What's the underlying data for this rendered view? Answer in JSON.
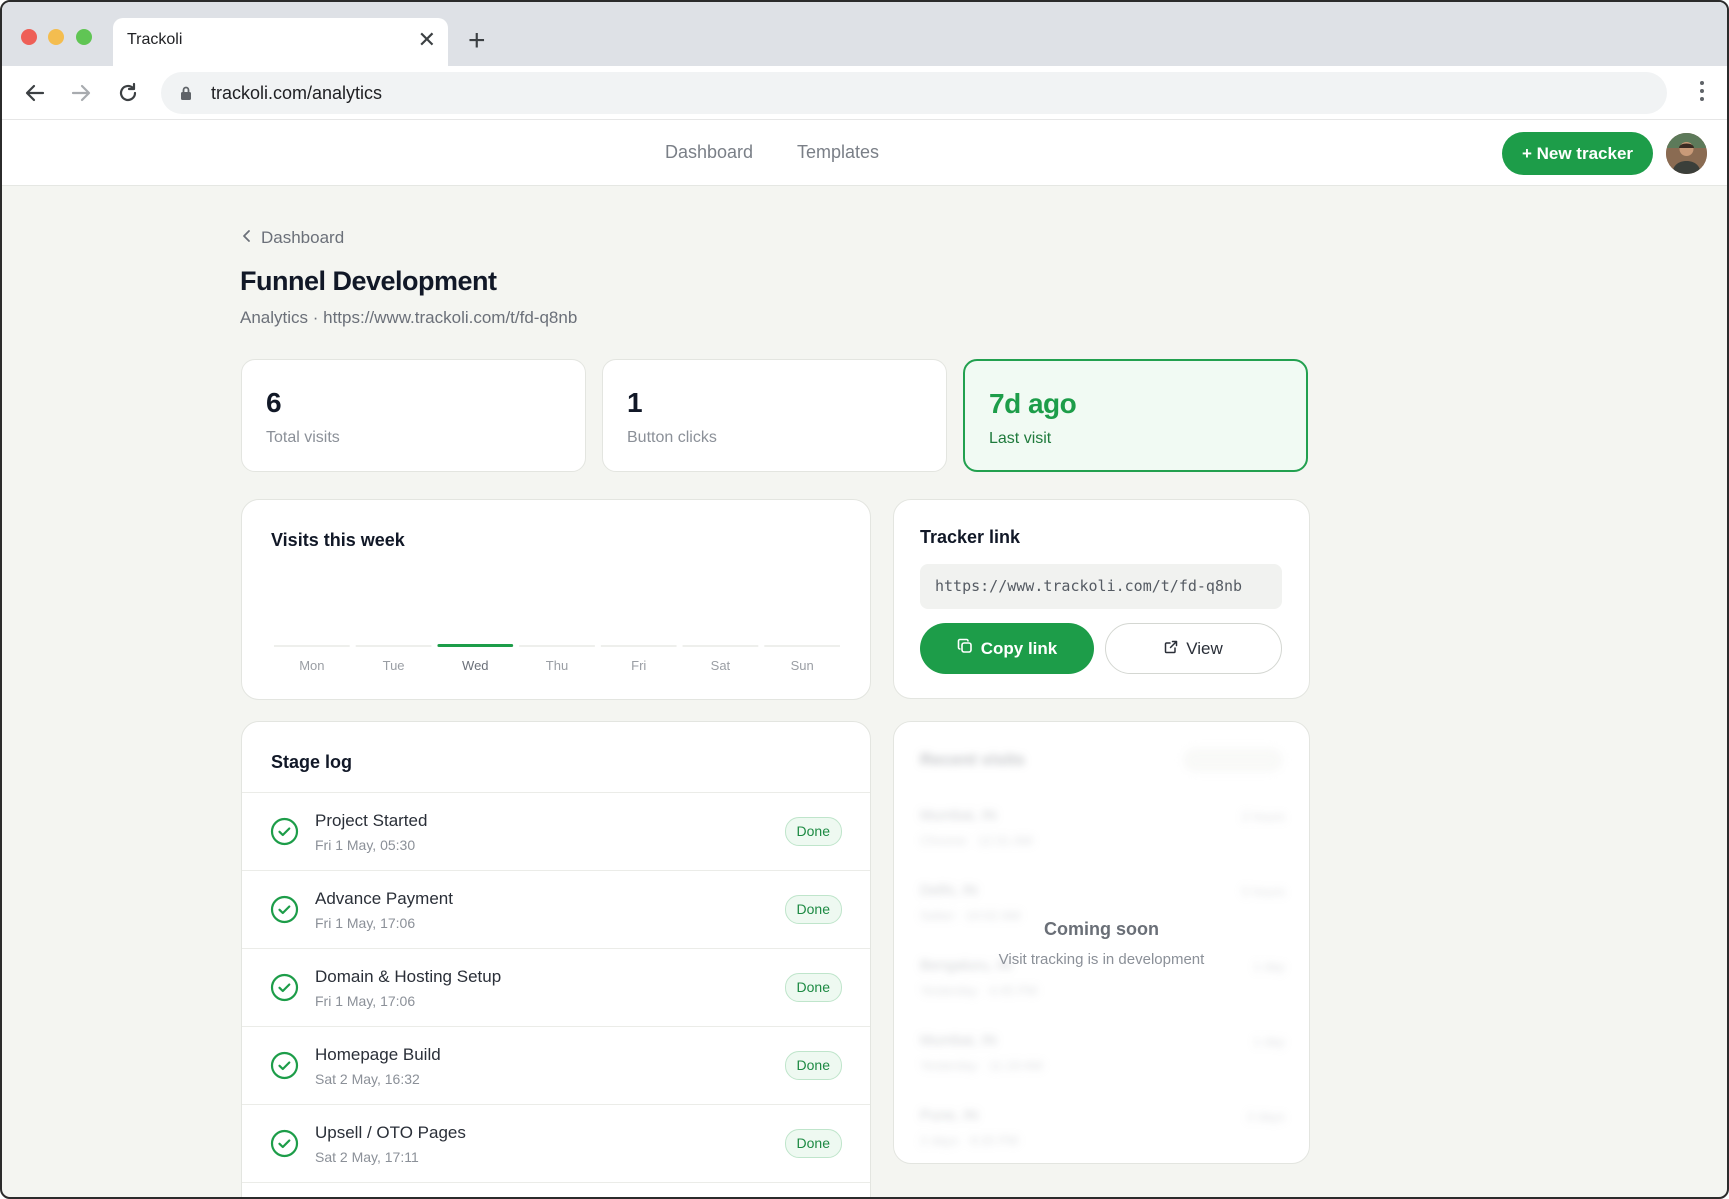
{
  "browser": {
    "tab_title": "Trackoli",
    "url": "trackoli.com/analytics"
  },
  "header": {
    "nav": [
      "Dashboard",
      "Templates"
    ],
    "new_tracker_label": "+ New tracker"
  },
  "page": {
    "breadcrumb": "Dashboard",
    "title": "Funnel Development",
    "subtitle": "Analytics · https://www.trackoli.com/t/fd-q8nb"
  },
  "stats": [
    {
      "value": "6",
      "label": "Total visits"
    },
    {
      "value": "1",
      "label": "Button clicks"
    },
    {
      "value": "7d ago",
      "label": "Last visit"
    }
  ],
  "visits_chart": {
    "title": "Visits this week",
    "chart_data": {
      "type": "bar",
      "categories": [
        "Mon",
        "Tue",
        "Wed",
        "Thu",
        "Fri",
        "Sat",
        "Sun"
      ],
      "values": [
        0,
        0,
        1,
        0,
        0,
        0,
        0
      ],
      "highlight": "Wed",
      "accent_color": "#1d9d49"
    }
  },
  "tracker_link": {
    "title": "Tracker link",
    "url": "https://www.trackoli.com/t/fd-q8nb",
    "copy_label": "Copy link",
    "view_label": "View"
  },
  "stage_log": {
    "title": "Stage log",
    "items": [
      {
        "name": "Project Started",
        "date": "Fri 1 May, 05:30",
        "status": "Done"
      },
      {
        "name": "Advance Payment",
        "date": "Fri 1 May, 17:06",
        "status": "Done"
      },
      {
        "name": "Domain & Hosting Setup",
        "date": "Fri 1 May, 17:06",
        "status": "Done"
      },
      {
        "name": "Homepage Build",
        "date": "Sat 2 May, 16:32",
        "status": "Done"
      },
      {
        "name": "Upsell / OTO Pages",
        "date": "Sat 2 May, 17:11",
        "status": "Done"
      }
    ]
  },
  "recent_visits": {
    "title": "Recent visits",
    "coming_soon_title": "Coming soon",
    "coming_soon_subtitle": "Visit tracking is in development",
    "placeholder_rows": [
      {
        "a": "Mumbai, IN",
        "b": "Chrome · 12:31 AM",
        "c": "2 hours"
      },
      {
        "a": "Delhi, IN",
        "b": "Safari · 10:02 AM",
        "c": "5 hours"
      },
      {
        "a": "Bengaluru, IN",
        "b": "Yesterday · 4:45 PM",
        "c": "1 day"
      },
      {
        "a": "Mumbai, IN",
        "b": "Yesterday · 11:18 AM",
        "c": "1 day"
      },
      {
        "a": "Pune, IN",
        "b": "2 days · 9:20 PM",
        "c": "2 days"
      }
    ]
  },
  "colors": {
    "accent": "#1d9d49",
    "background": "#f4f5f1"
  }
}
